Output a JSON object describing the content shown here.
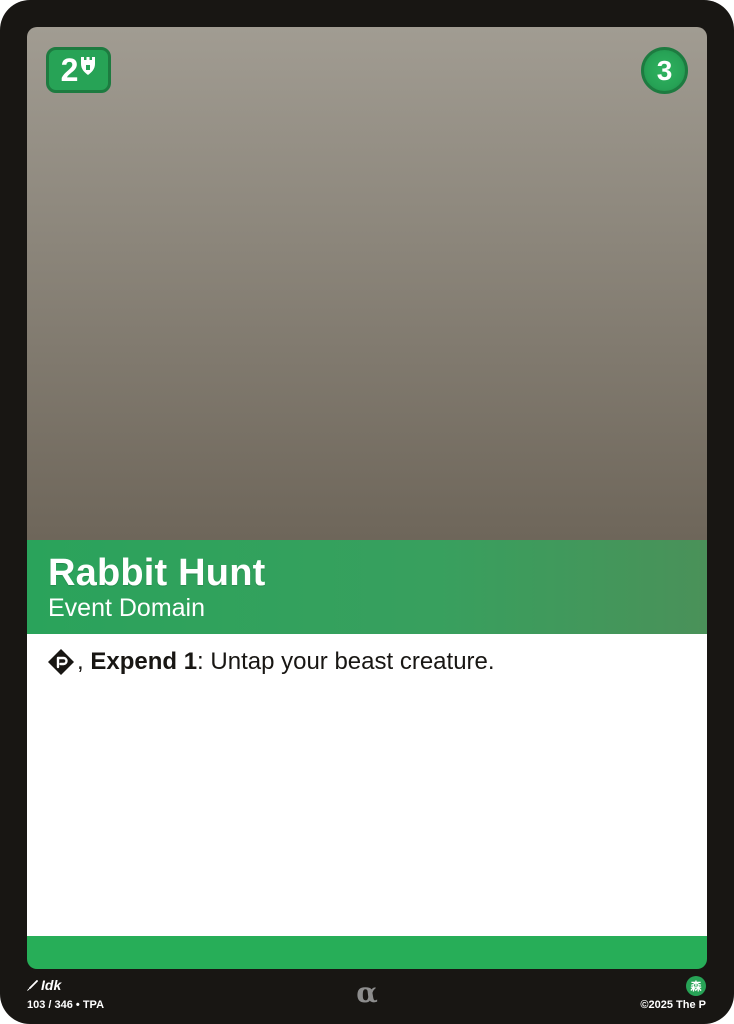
{
  "card": {
    "cost": "2",
    "cost_icon": "tower-icon",
    "power": "3",
    "title": "Rabbit Hunt",
    "type_line": "Event Domain",
    "ability": {
      "cost_icon": "tap-icon",
      "cost_separator": ",",
      "keyword": "Expend 1",
      "colon": ":",
      "effect": "Untap your beast creature."
    }
  },
  "footer": {
    "artist": "Idk",
    "collector_number": "103 / 346 • TPA",
    "rarity_symbol": "α",
    "domain_symbol": "森",
    "copyright": "©2025 The P"
  },
  "colors": {
    "card_border": "#181613",
    "domain_green": "#27a356",
    "badge_border": "#1d7b40",
    "text_box": "#ffffff",
    "text": "#181613"
  }
}
